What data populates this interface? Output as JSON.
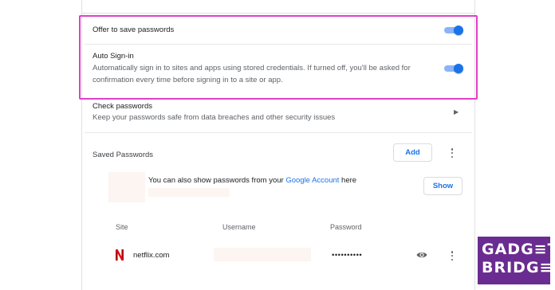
{
  "settings": {
    "offer_to_save": {
      "label": "Offer to save passwords",
      "enabled": true
    },
    "auto_signin": {
      "label": "Auto Sign-in",
      "description": "Automatically sign in to sites and apps using stored credentials. If turned off, you'll be asked for confirmation every time before signing in to a site or app.",
      "enabled": true
    },
    "check_passwords": {
      "label": "Check passwords",
      "description": "Keep your passwords safe from data breaches and other security issues"
    }
  },
  "saved_passwords": {
    "title": "Saved Passwords",
    "add_label": "Add",
    "info_prefix": "You can also show passwords from your ",
    "info_link": "Google Account",
    "info_suffix": " here",
    "show_label": "Show",
    "columns": {
      "site": "Site",
      "username": "Username",
      "password": "Password"
    },
    "rows": [
      {
        "site": "netflix.com",
        "username": "",
        "password": "••••••••••"
      }
    ]
  },
  "colors": {
    "accent": "#1a73e8",
    "highlight": "#e040c8",
    "netflix": "#e50914",
    "logo_bg": "#6a2c91"
  },
  "logo": {
    "line1": "GADG≡T",
    "line2": "BRIDG≡"
  }
}
